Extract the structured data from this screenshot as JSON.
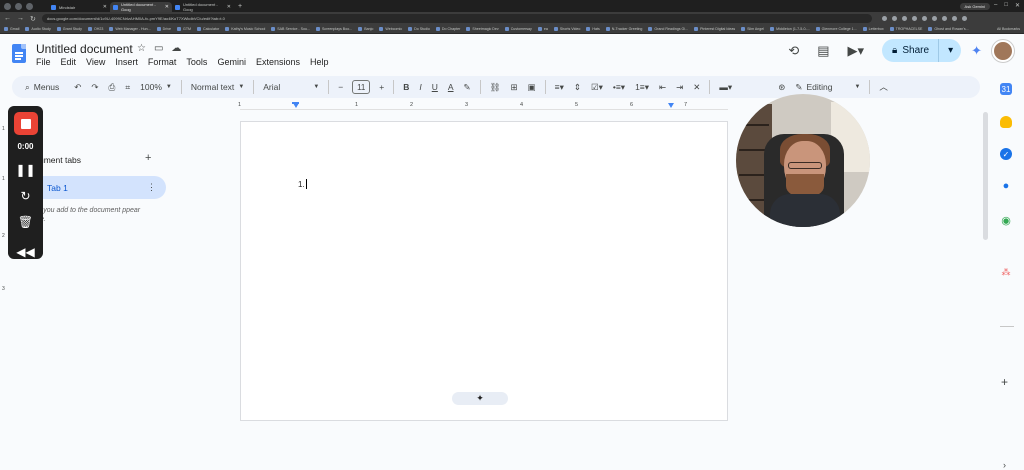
{
  "browser": {
    "tabs": [
      {
        "label": "Mindstair"
      },
      {
        "label": "Untitled document - Goog"
      },
      {
        "label": "Untitled document - Goog"
      }
    ],
    "active_tab": 1,
    "url": "docs.google.com/document/d/1c9U-4099CNrIzAHM0A-fc-pmY9E/ao4lKoT7XWkdbVCIu/edit?tab=t.0",
    "ask_gemini": "Ask Gemini",
    "bookmarks": [
      "Gmail",
      "Audio Study",
      "Grant Study",
      "OH23",
      "Web Manager - Hun...",
      "Drive",
      "GTM",
      "Calculator",
      "Kathy's Music School",
      "SAB Service - Sou...",
      "Screenplays Boo...",
      "Banjo",
      "Webcomic",
      "Do Studio",
      "Do Chapter",
      "Sheetmagic Dev",
      "Customersay",
      "ea",
      "Shorts Video",
      "Hats",
      "N-Tracker Greeting",
      "Grand Readings Gi...",
      "Pinterest Digital Ideas",
      "Slim Angel",
      "Middleton (1-7-5-0-...",
      "Glenmore College 1...",
      "Letterbox",
      "TROPHACELSE",
      "Ghost and Rowan's..."
    ],
    "all_bookmarks": "All Bookmarks"
  },
  "docs": {
    "title": "Untitled document",
    "menus": [
      "File",
      "Edit",
      "View",
      "Insert",
      "Format",
      "Tools",
      "Gemini",
      "Extensions",
      "Help"
    ],
    "share_label": "Share"
  },
  "toolbar": {
    "menus_label": "Menus",
    "zoom": "100%",
    "style": "Normal text",
    "font": "Arial",
    "font_size": "11",
    "mode": "Editing"
  },
  "ruler": {
    "numbers": [
      "1",
      "1",
      "2",
      "3",
      "4",
      "5",
      "6",
      "7"
    ]
  },
  "vruler": [
    "1",
    "1",
    "2",
    "3"
  ],
  "document": {
    "content": "1."
  },
  "tabs_panel": {
    "title": "ocument tabs",
    "tab": "Tab 1",
    "hint": "ngs you add to the document ppear here."
  },
  "recorder": {
    "time": "0:00"
  },
  "colors": {
    "accent": "#0b57d0",
    "share_bg": "#c2e7ff",
    "tab_highlight": "#d3e3fd",
    "record_red": "#ea4335",
    "toolbar_bg": "#edf2fa",
    "page_bg": "#f9fbfd"
  },
  "icons": {
    "side_panel": [
      "calendar-icon",
      "keep-icon",
      "tasks-icon",
      "contacts-icon",
      "maps-icon",
      "asana-icon"
    ]
  }
}
